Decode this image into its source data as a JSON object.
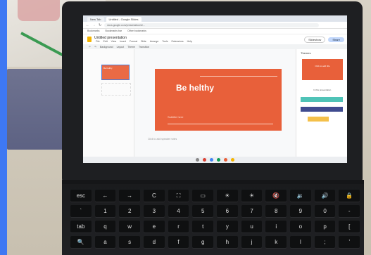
{
  "browser": {
    "tabs": [
      "New Tab",
      "Untitled - Google Slides"
    ],
    "url": "docs.google.com/presentation/d/...",
    "bookmarks": [
      "Bookmarks",
      "Bookmarks bar",
      "Other bookmarks"
    ]
  },
  "app": {
    "doc_title": "Untitled presentation",
    "menus": [
      "File",
      "Edit",
      "View",
      "Insert",
      "Format",
      "Slide",
      "Arrange",
      "Tools",
      "Extensions",
      "Help"
    ],
    "slideshow_label": "Slideshow",
    "share_label": "Share",
    "toolbar_items": [
      "Background",
      "Layout",
      "Theme",
      "Transition"
    ]
  },
  "slides": {
    "thumb_title": "Be helthy",
    "slide_title": "Be helthy",
    "slide_subtitle": "Subtitle here",
    "notes_placeholder": "Click to add speaker notes"
  },
  "themes": {
    "panel_title": "Themes",
    "theme_caption": "Click to add title",
    "label": "In this presentation"
  },
  "keyboard": {
    "row1": [
      "esc",
      "←",
      "→",
      "C",
      "⛶",
      "▭",
      "☀",
      "☀",
      "🔇",
      "🔉",
      "🔊",
      "🔒"
    ],
    "row2": [
      "`",
      "1",
      "2",
      "3",
      "4",
      "5",
      "6",
      "7",
      "8",
      "9",
      "0",
      "-"
    ],
    "row3": [
      "tab",
      "q",
      "w",
      "e",
      "r",
      "t",
      "y",
      "u",
      "i",
      "o",
      "p",
      "["
    ],
    "row4": [
      "🔍",
      "a",
      "s",
      "d",
      "f",
      "g",
      "h",
      "j",
      "k",
      "l",
      ";",
      "'"
    ]
  },
  "colors": {
    "slide_orange": "#e8603a",
    "bezel": "#1e1f22",
    "swatch_teal": "#4fc3b7",
    "swatch_navy": "#3f4b8f",
    "swatch_yellow": "#f4c04a"
  }
}
